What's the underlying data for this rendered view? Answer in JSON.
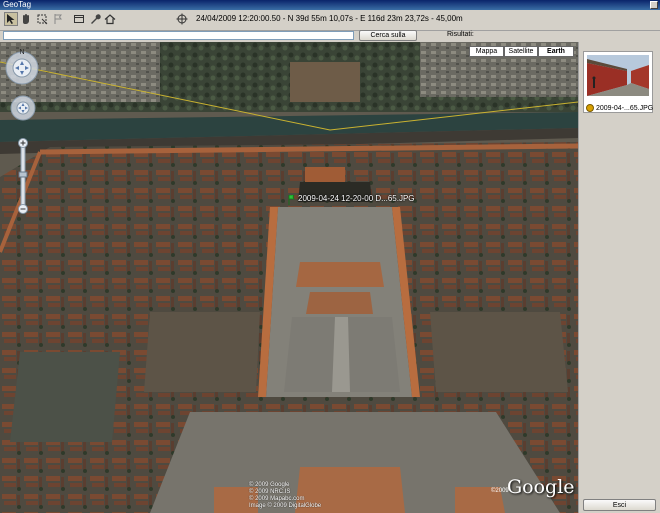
{
  "window": {
    "title": "GeoTag"
  },
  "toolbar": {
    "coordinates": "24/04/2009 12:20:00.50 - N 39d 55m 10,07s - E 116d 23m 23,72s - 45,00m",
    "tools": [
      {
        "name": "pointer-icon",
        "glyph": "↖"
      },
      {
        "name": "hand-icon",
        "glyph": "✋"
      },
      {
        "name": "select-icon",
        "glyph": "⬚"
      },
      {
        "name": "flag-icon",
        "glyph": "⚐"
      },
      {
        "name": "window-icon",
        "glyph": "▭"
      },
      {
        "name": "wrench-icon",
        "glyph": "🔧"
      },
      {
        "name": "home-icon",
        "glyph": "⌂"
      },
      {
        "name": "crosshair-icon",
        "glyph": "⌖"
      }
    ]
  },
  "search": {
    "value": "",
    "button_label": "Cerca sulla mappa",
    "results_label": "Risultati:"
  },
  "map": {
    "types": [
      "Mappa",
      "Satellite",
      "Earth"
    ],
    "active_type": "Earth",
    "compass_label": "N",
    "marker_label": "2009-04-24 12-20-00 D...65.JPG",
    "copyright": [
      "© 2009 Google",
      "© 2009 NRC.IS",
      "© 2009 Mapabc.com",
      "Image © 2009 DigitalGlobe"
    ],
    "logo_text": "Google",
    "logo_year": "©2009"
  },
  "sidebar": {
    "photo_caption": "2009-04-...65.JPG",
    "exit_label": "Esci"
  }
}
